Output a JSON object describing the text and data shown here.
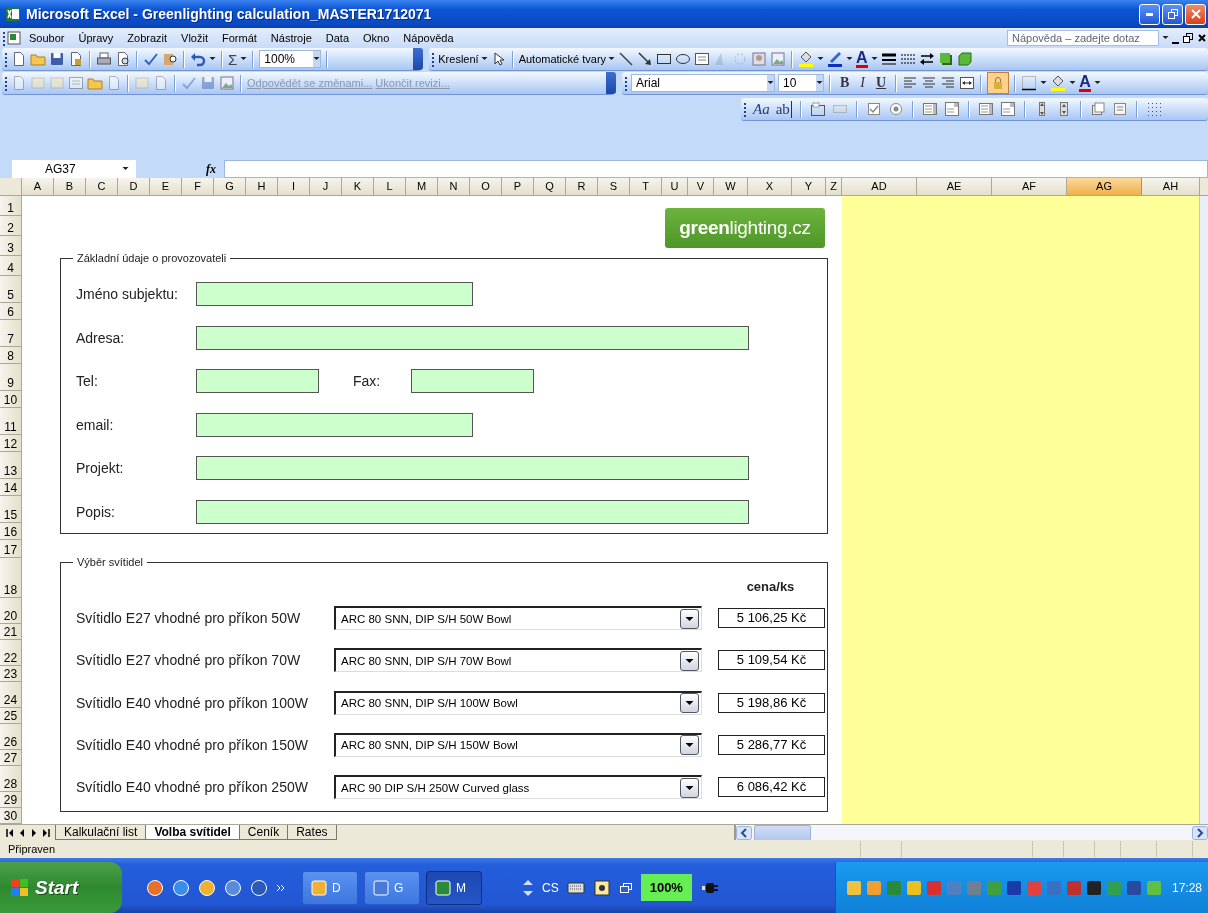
{
  "window": {
    "title": "Microsoft Excel - Greenlighting calculation_MASTER1712071"
  },
  "menu": {
    "items": [
      "Soubor",
      "Úpravy",
      "Zobrazit",
      "Vložit",
      "Formát",
      "Nástroje",
      "Data",
      "Okno",
      "Nápověda"
    ],
    "help_box": {
      "placeholder": "Nápověda – zadejte dotaz"
    }
  },
  "standard_toolbar": {
    "sum": "Σ",
    "zoom": "100%"
  },
  "drawing_toolbar": {
    "draw_menu": "Kreslení",
    "autoshapes_menu": "Automatické tvary",
    "font_color": "A"
  },
  "reviewing_toolbar": {
    "buttons": [
      {
        "label": "Odpovědět se změnami...",
        "disabled": true
      },
      {
        "label": "Ukončit revizi...",
        "disabled": true
      }
    ]
  },
  "formatting_toolbar": {
    "font": "Arial",
    "font_size": "10",
    "bold": "B",
    "italic": "I",
    "underline": "U",
    "protect_on": true,
    "font_color": "A"
  },
  "forms_toolbar": {
    "label_tool": "Aa",
    "text_field_tool": "ab"
  },
  "formula_bar": {
    "name_box": "AG37",
    "function_button": "fx"
  },
  "columns": [
    {
      "label": "A",
      "selected": false
    },
    {
      "label": "B",
      "selected": false
    },
    {
      "label": "C",
      "selected": false
    },
    {
      "label": "D",
      "selected": false
    },
    {
      "label": "E",
      "selected": false
    },
    {
      "label": "F",
      "selected": false
    },
    {
      "label": "G",
      "selected": false
    },
    {
      "label": "H",
      "selected": false
    },
    {
      "label": "I",
      "selected": false
    },
    {
      "label": "J",
      "selected": false
    },
    {
      "label": "K",
      "selected": false
    },
    {
      "label": "L",
      "selected": false
    },
    {
      "label": "M",
      "selected": false
    },
    {
      "label": "N",
      "selected": false
    },
    {
      "label": "O",
      "selected": false
    },
    {
      "label": "P",
      "selected": false
    },
    {
      "label": "Q",
      "selected": false
    },
    {
      "label": "R",
      "selected": false
    },
    {
      "label": "S",
      "selected": false
    },
    {
      "label": "T",
      "selected": false
    },
    {
      "label": "U",
      "selected": false
    },
    {
      "label": "V",
      "selected": false
    },
    {
      "label": "W",
      "selected": false
    },
    {
      "label": "X",
      "selected": false
    },
    {
      "label": "Y",
      "selected": false
    },
    {
      "label": "Z",
      "selected": false
    },
    {
      "label": "AD",
      "selected": false
    },
    {
      "label": "AE",
      "selected": false
    },
    {
      "label": "AF",
      "selected": false
    },
    {
      "label": "AG",
      "selected": true
    },
    {
      "label": "AH",
      "selected": false
    }
  ],
  "rows": [
    "1",
    "2",
    "3",
    "4",
    "5",
    "6",
    "7",
    "8",
    "9",
    "10",
    "11",
    "12",
    "13",
    "14",
    "15",
    "16",
    "17",
    "18",
    "20",
    "21",
    "22",
    "23",
    "24",
    "25",
    "26",
    "27",
    "28",
    "29",
    "30"
  ],
  "logo": "**green**lighting.cz",
  "operator_section": {
    "title": "Základní údaje o provozovateli",
    "fields": [
      {
        "kind": "medium",
        "label": "Jméno subjektu:"
      },
      {
        "kind": "long",
        "label": "Adresa:"
      },
      {
        "kind": "pair",
        "label": "Tel:",
        "label_2": "Fax:"
      },
      {
        "kind": "medium",
        "label": "email:"
      },
      {
        "kind": "long",
        "label": "Projekt:"
      },
      {
        "kind": "long",
        "label": "Popis:"
      }
    ]
  },
  "luminaire_section": {
    "title": "Výběr svítidel",
    "price_header": "cena/ks",
    "items": [
      {
        "label": "Svítidlo E27 vhodné pro příkon 50W",
        "selection": "ARC 80 SNN, DIP S/H 50W Bowl",
        "price": "5 106,25 Kč"
      },
      {
        "label": "Svítidlo E27 vhodné pro příkon 70W",
        "selection": "ARC 80 SNN, DIP S/H 70W Bowl",
        "price": "5 109,54 Kč"
      },
      {
        "label": "Svítidlo E40 vhodné pro příkon 100W",
        "selection": "ARC 80 SNN, DIP S/H 100W Bowl",
        "price": "5 198,86 Kč"
      },
      {
        "label": "Svítidlo E40 vhodné pro příkon 150W",
        "selection": "ARC 80 SNN, DIP S/H 150W Bowl",
        "price": "5 286,77 Kč"
      },
      {
        "label": "Svítidlo E40 vhodné pro příkon 250W",
        "selection": "ARC 90 DIP S/H 250W Curved glass",
        "price": "6 086,42 Kč"
      }
    ]
  },
  "sheet_tabs": [
    {
      "label": "Kalkulační list",
      "selected": false
    },
    {
      "label": "Volba svítidel",
      "selected": true
    },
    {
      "label": "Ceník",
      "selected": false
    },
    {
      "label": "Rates",
      "selected": false
    }
  ],
  "status_bar": {
    "text": "Připraven"
  },
  "taskbar": {
    "start": "Start",
    "tasks": [
      {
        "label": "D",
        "selected": false
      },
      {
        "label": "G",
        "selected": false
      },
      {
        "label": "M",
        "selected": true
      }
    ],
    "language": "CS",
    "battery": "100%",
    "clock": "17:28"
  }
}
